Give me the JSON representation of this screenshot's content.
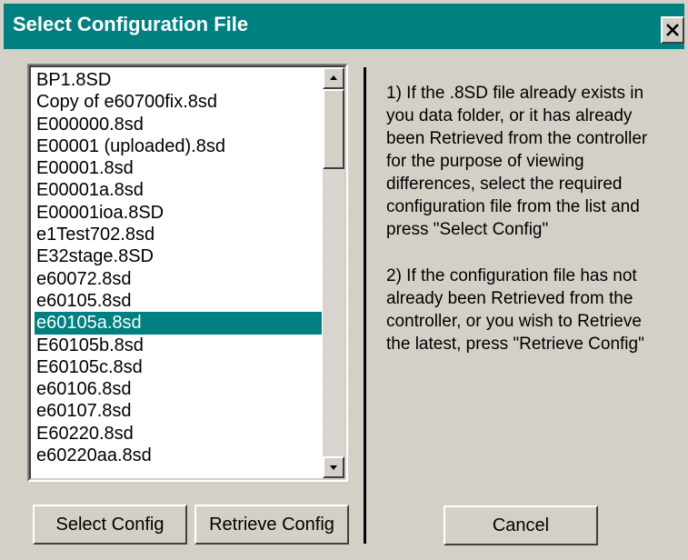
{
  "window": {
    "title": "Select Configuration File",
    "close_icon": "close-icon"
  },
  "file_list": {
    "items": [
      "BP1.8SD",
      "Copy of e60700fix.8sd",
      "E000000.8sd",
      "E00001 (uploaded).8sd",
      "E00001.8sd",
      "E00001a.8sd",
      "E00001ioa.8SD",
      "e1Test702.8sd",
      "E32stage.8SD",
      "e60072.8sd",
      "e60105.8sd",
      "e60105a.8sd",
      "E60105b.8sd",
      "E60105c.8sd",
      "e60106.8sd",
      "e60107.8sd",
      "E60220.8sd",
      "e60220aa.8sd"
    ],
    "selected_index": 11,
    "selection_color": "#008080"
  },
  "help": {
    "paragraph1": "1) If the .8SD file already exists in\nyou data folder, or it has already\nbeen Retrieved from the controller\nfor the purpose of viewing\ndifferences, select the required\nconfiguration file from the list and\npress \"Select Config\"",
    "paragraph2": "2) If the configuration file has not\nalready been Retrieved from the\ncontroller, or you wish to Retrieve\nthe latest, press \"Retrieve Config\""
  },
  "buttons": {
    "select_label": "Select Config",
    "retrieve_label": "Retrieve Config",
    "cancel_label": "Cancel"
  },
  "colors": {
    "title_bar": "#008080",
    "dialog_bg": "#d4d0c8"
  }
}
